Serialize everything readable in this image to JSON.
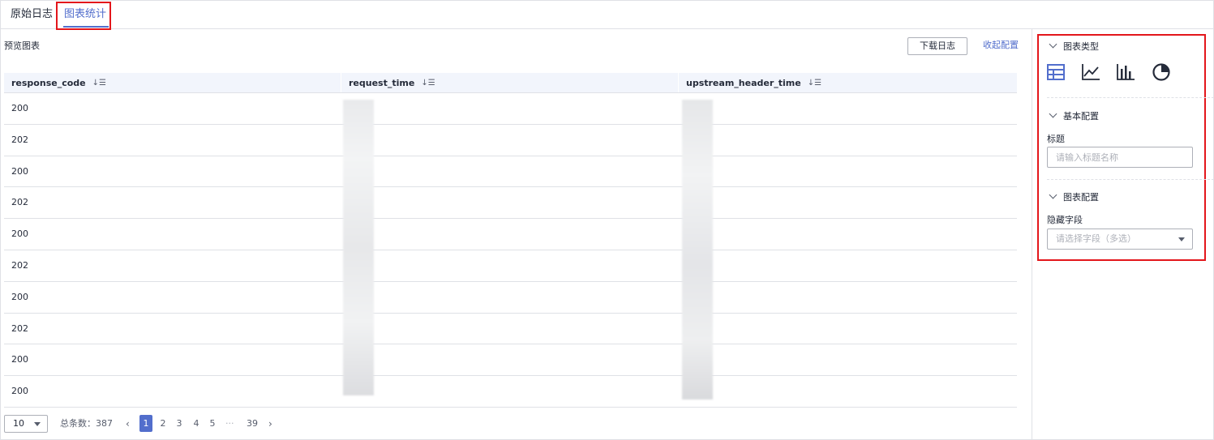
{
  "tabs": [
    {
      "label": "原始日志",
      "active": false
    },
    {
      "label": "图表统计",
      "active": true
    }
  ],
  "preview": {
    "title": "预览图表",
    "download_label": "下载日志",
    "collapse_label": "收起配置"
  },
  "table": {
    "columns": [
      "response_code",
      "request_time",
      "upstream_header_time"
    ],
    "rows": [
      [
        "200",
        "",
        ""
      ],
      [
        "202",
        "",
        ""
      ],
      [
        "200",
        "",
        ""
      ],
      [
        "202",
        "",
        ""
      ],
      [
        "200",
        "",
        ""
      ],
      [
        "202",
        "",
        ""
      ],
      [
        "200",
        "",
        ""
      ],
      [
        "202",
        "",
        ""
      ],
      [
        "200",
        "",
        ""
      ],
      [
        "200",
        "",
        ""
      ]
    ]
  },
  "pagination": {
    "page_size": "10",
    "total_text": "总条数：387",
    "pages": [
      "1",
      "2",
      "3",
      "4",
      "5"
    ],
    "ellipsis": "···",
    "last_page": "39",
    "current": "1"
  },
  "config": {
    "chart_type_title": "图表类型",
    "chart_types": [
      "table-icon",
      "line-chart-icon",
      "bar-chart-icon",
      "pie-chart-icon"
    ],
    "basic_title": "基本配置",
    "title_label": "标题",
    "title_placeholder": "请输入标题名称",
    "chart_config_title": "图表配置",
    "hide_fields_label": "隐藏字段",
    "hide_fields_placeholder": "请选择字段（多选）"
  },
  "colors": {
    "accent": "#526ecc",
    "highlight": "#e3161b",
    "border": "#dfe1e6"
  }
}
